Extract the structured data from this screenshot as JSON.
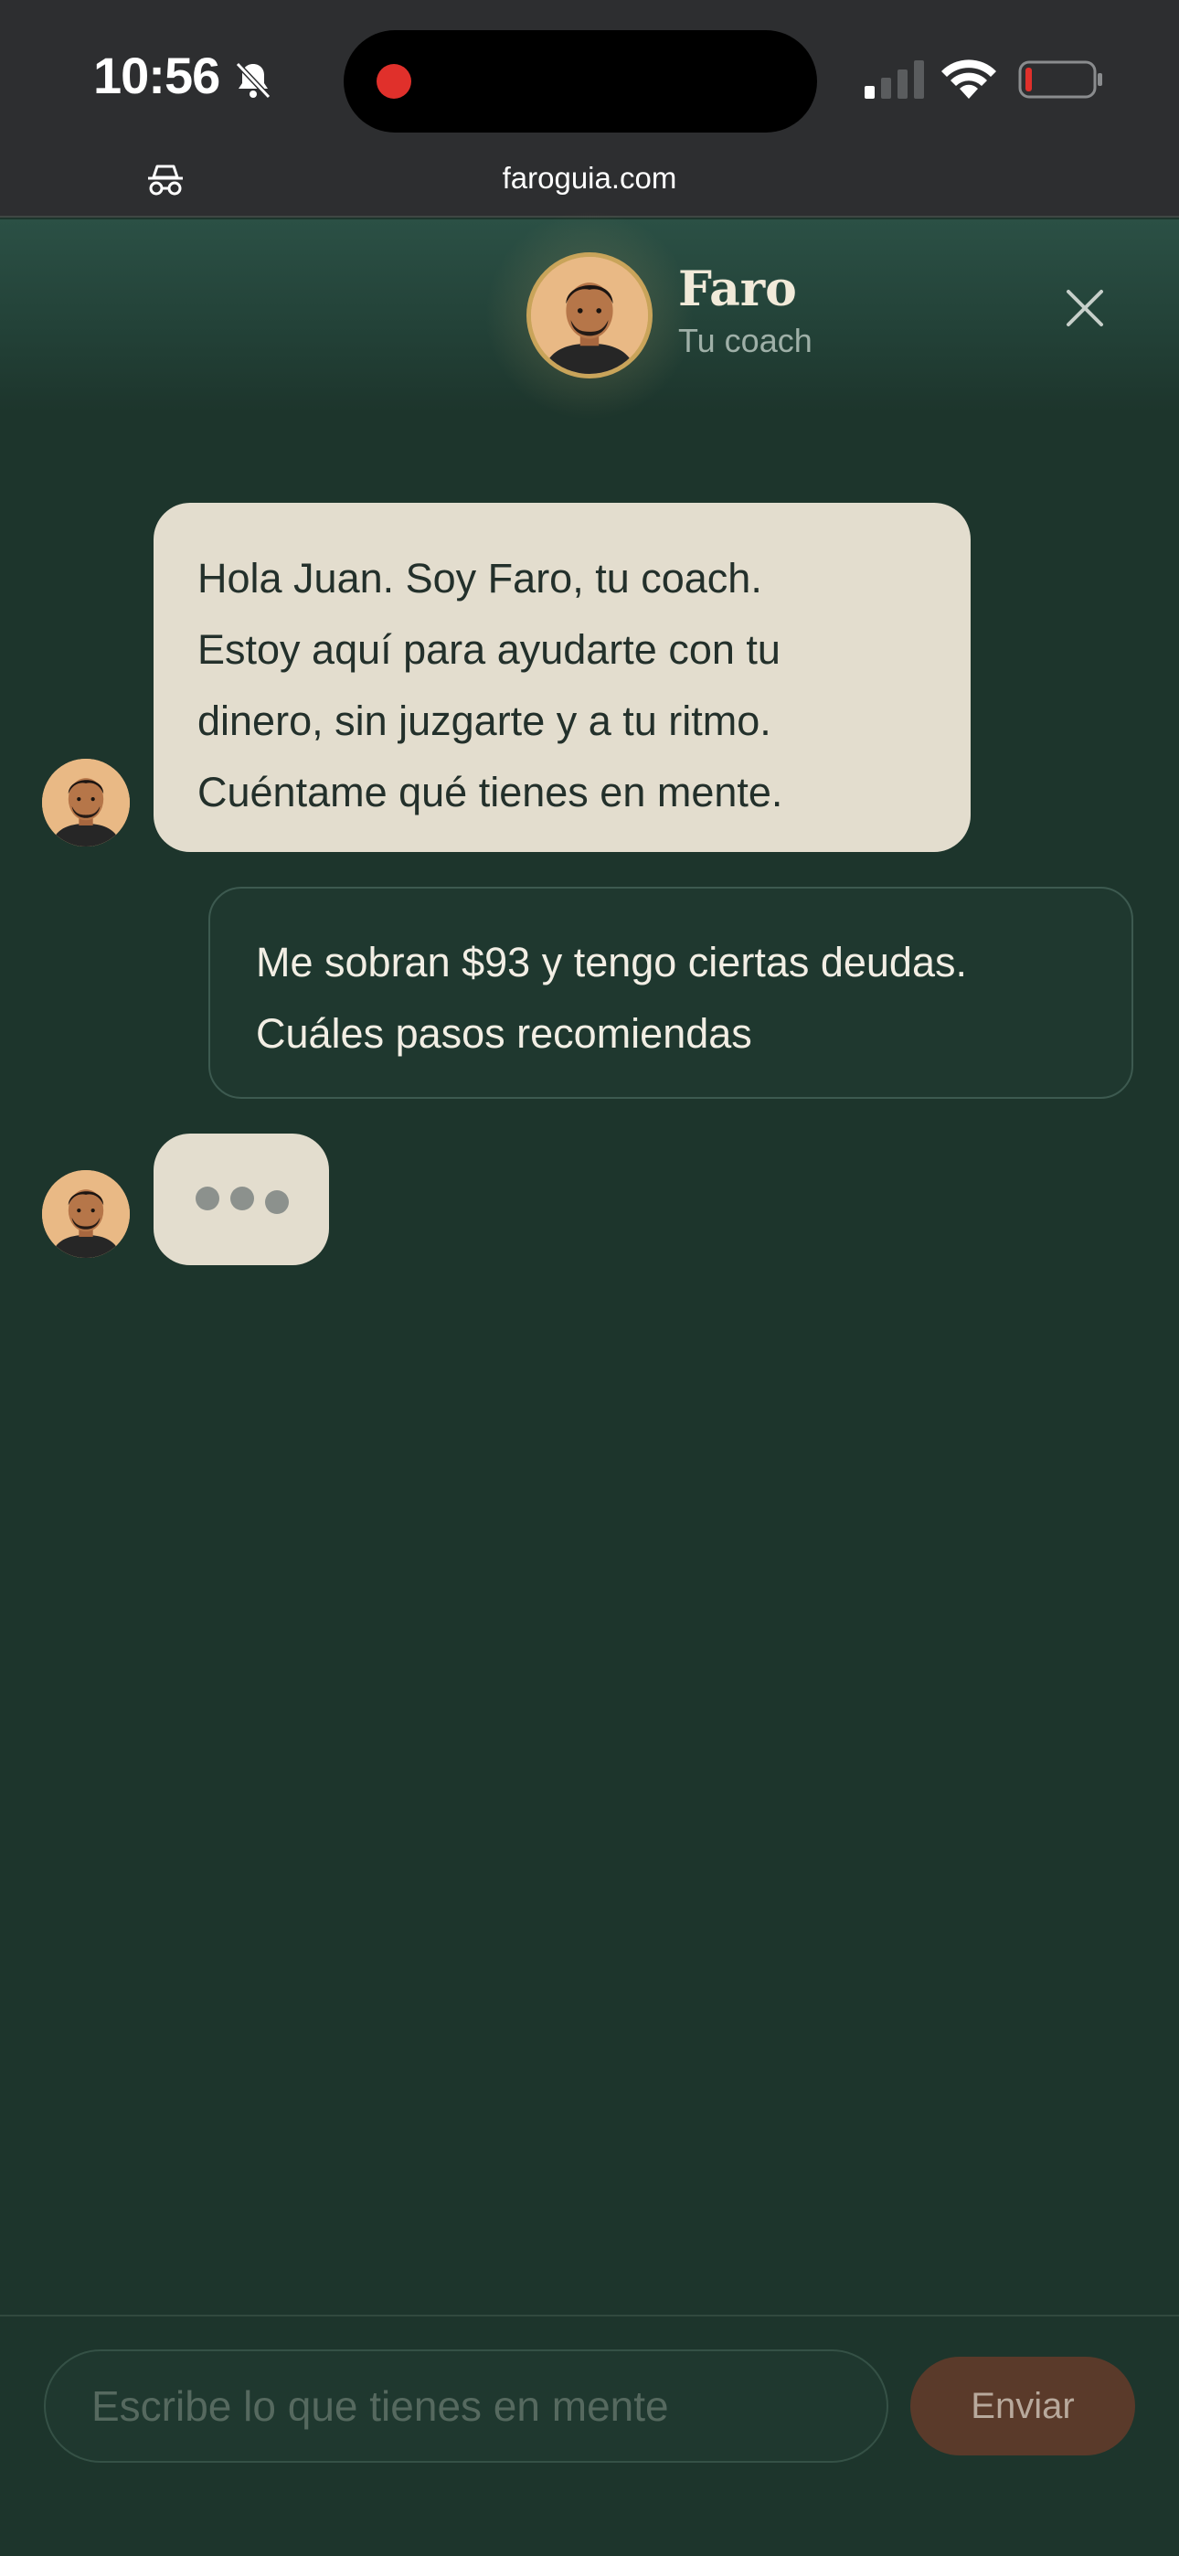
{
  "status_bar": {
    "time": "10:56",
    "icons": [
      "bell-muted-icon",
      "recording-dot-icon",
      "cellular-signal-icon",
      "wifi-icon",
      "battery-low-icon"
    ]
  },
  "browser": {
    "url": "faroguia.com",
    "icons": [
      "incognito-icon"
    ]
  },
  "header": {
    "name": "Faro",
    "subtitle": "Tu coach",
    "close_icon": "close-icon"
  },
  "messages": [
    {
      "sender": "coach",
      "lines": [
        "Hola Juan. Soy Faro, tu coach.",
        "Estoy aquí para ayudarte con tu",
        "dinero, sin juzgarte y a tu ritmo.",
        "Cuéntame qué tienes en mente."
      ]
    },
    {
      "sender": "user",
      "lines": [
        "Me sobran $93 y tengo ciertas deudas.",
        "Cuáles pasos recomiendas"
      ]
    }
  ],
  "composer": {
    "placeholder": "Escribe lo que tienes en mente",
    "value": "",
    "send_label": "Enviar"
  },
  "colors": {
    "background": "#1d352c",
    "coach_bubble": "#e3ddce",
    "accent_gold": "#c9a45a",
    "send_button": "#5a3a2a",
    "recording": "#e0302b"
  }
}
